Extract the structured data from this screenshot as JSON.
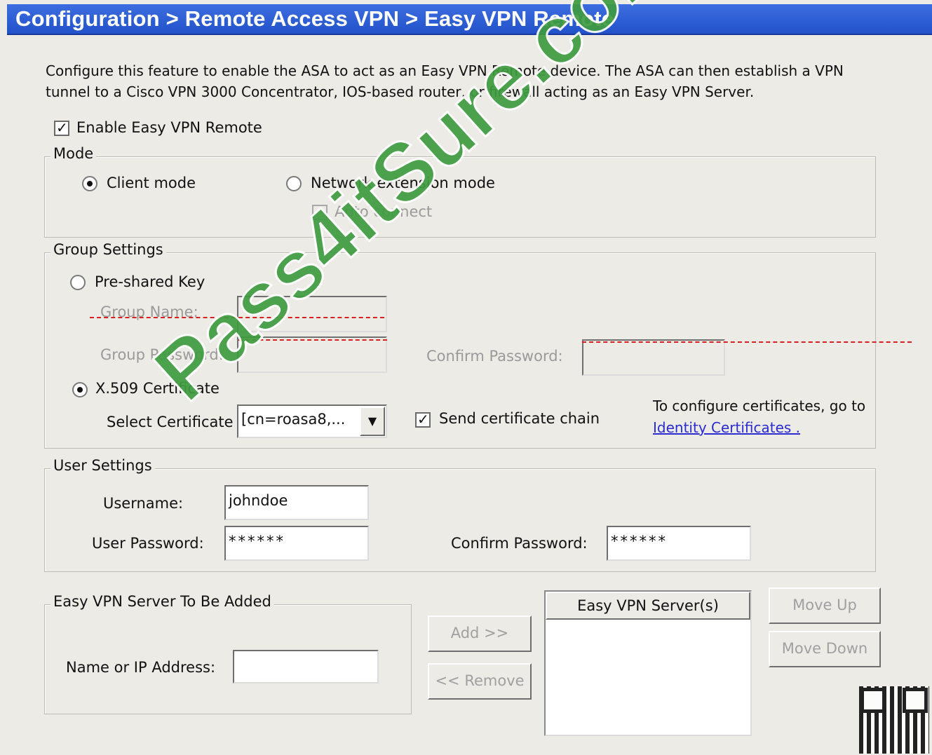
{
  "header": {
    "breadcrumb": "Configuration > Remote Access VPN > Easy VPN Remote"
  },
  "description": "Configure this feature to enable the ASA to act as an Easy VPN Remote device. The ASA can then establish a VPN tunnel to a Cisco VPN 3000 Concentrator, IOS-based router, or firewall acting as an Easy VPN Server.",
  "enable": {
    "label": "Enable Easy VPN Remote",
    "checked": true
  },
  "mode": {
    "legend": "Mode",
    "client_label": "Client mode",
    "network_label": "Network extension mode",
    "auto_connect_label": "Auto connect",
    "selected": "client"
  },
  "group_settings": {
    "legend": "Group Settings",
    "preshared_label": "Pre-shared Key",
    "group_name_label": "Group Name:",
    "group_password_label": "Group Password:",
    "confirm_password_label": "Confirm Password:",
    "x509_label": "X.509 Certificate",
    "select_cert_label": "Select Certificate",
    "select_cert_value": "[cn=roasa8,...",
    "send_chain_label": "Send certificate chain",
    "hint_text": "To configure certificates, go to",
    "hint_link": "Identity Certificates .",
    "selected": "x509"
  },
  "user_settings": {
    "legend": "User Settings",
    "username_label": "Username:",
    "username_value": "johndoe",
    "user_password_label": "User Password:",
    "user_password_value": "******",
    "confirm_password_label": "Confirm Password:",
    "confirm_password_value": "******"
  },
  "server_add": {
    "legend": "Easy VPN Server To Be Added",
    "name_ip_label": "Name or IP Address:",
    "name_ip_value": ""
  },
  "buttons": {
    "add": "Add >>",
    "remove": "<< Remove",
    "move_up": "Move Up",
    "move_down": "Move Down"
  },
  "server_list": {
    "header": "Easy VPN Server(s)",
    "items": []
  },
  "watermark": "Pass4itSure.com"
}
